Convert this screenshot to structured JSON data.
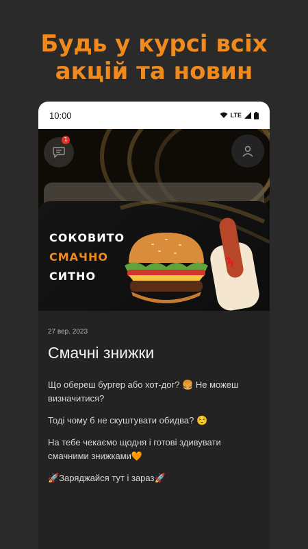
{
  "headline": {
    "line1": "Будь у курсі всіх",
    "line2": "акцій та новин"
  },
  "status_bar": {
    "time": "10:00",
    "network": "LTE"
  },
  "app": {
    "chat_badge_count": "1"
  },
  "banner": {
    "line1": "СОКОВИТО",
    "line2": "СМАЧНО",
    "line3": "СИТНО"
  },
  "post": {
    "date": "27 вер. 2023",
    "title": "Смачні знижки",
    "paragraphs": [
      "Що обереш бургер або хот-дог? 🍔 Не можеш визначитися?",
      "Тоді чому б не скуштувати обидва? ☺️",
      "На тебе чекаємо щодня і готові здивувати смачними знижками🧡",
      "🚀Заряджайся тут і зараз🚀"
    ]
  },
  "colors": {
    "accent": "#f08a1c",
    "background": "#2a2a2a",
    "card": "#232323"
  }
}
